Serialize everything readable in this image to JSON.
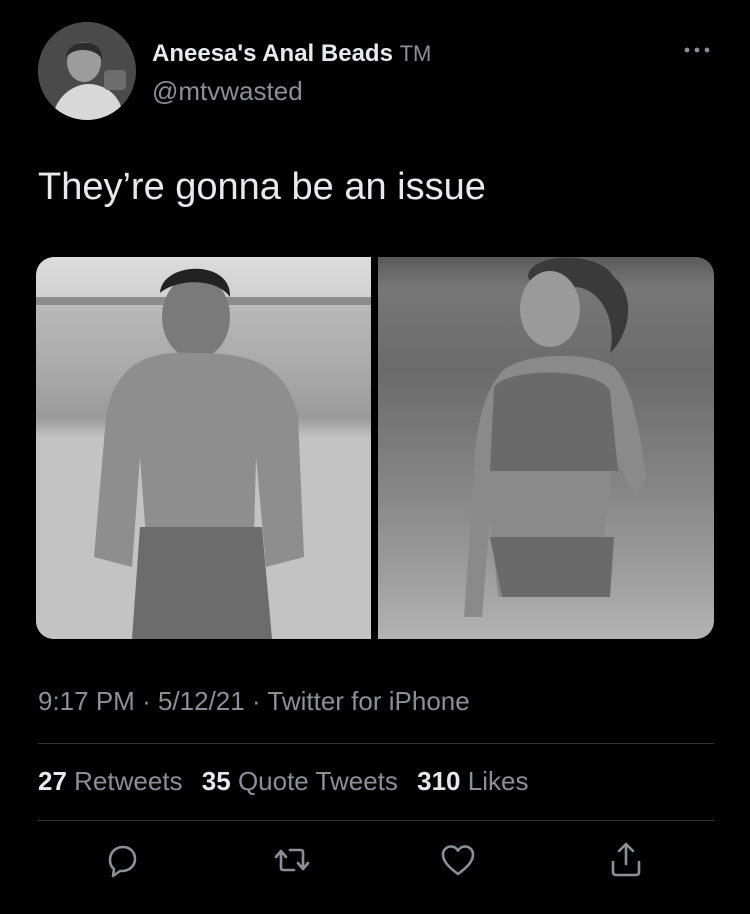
{
  "author": {
    "display_name": "Aneesa's Anal Beads",
    "display_name_suffix": "TM",
    "handle": "@mtvwasted",
    "avatar_icon": "profile-photo"
  },
  "tweet": {
    "text": "They’re gonna be an issue",
    "media": [
      {
        "description_icon": "photo-man-on-beach"
      },
      {
        "description_icon": "photo-woman-on-beach"
      }
    ],
    "time": "9:17 PM",
    "date": "5/12/21",
    "source": "Twitter for iPhone",
    "separator": "·"
  },
  "stats": {
    "retweets_count": "27",
    "retweets_label": "Retweets",
    "quote_tweets_count": "35",
    "quote_tweets_label": "Quote Tweets",
    "likes_count": "310",
    "likes_label": "Likes"
  },
  "actions": {
    "reply_icon": "reply-icon",
    "retweet_icon": "retweet-icon",
    "like_icon": "heart-icon",
    "share_icon": "share-icon"
  },
  "colors": {
    "background": "#000000",
    "primary_text": "#e7e9ea",
    "secondary_text": "#8b9095",
    "divider": "#2f3336"
  }
}
